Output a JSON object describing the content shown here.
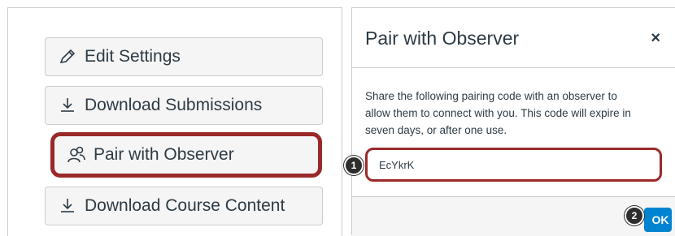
{
  "left_panel": {
    "buttons": [
      {
        "label": "Edit Settings",
        "icon": "pencil-icon"
      },
      {
        "label": "Download Submissions",
        "icon": "download-icon"
      },
      {
        "label": "Pair with Observer",
        "icon": "observer-icon"
      },
      {
        "label": "Download Course Content",
        "icon": "download-icon"
      }
    ]
  },
  "dialog": {
    "title": "Pair with Observer",
    "close_label": "×",
    "description": "Share the following pairing code with an observer to allow them to connect with you. This code will expire in seven days, or after one use.",
    "pairing_code": "EcYkrK",
    "ok_label": "OK"
  },
  "markers": [
    "1",
    "2"
  ],
  "colors": {
    "highlight": "#9b2929",
    "primary_button": "#0084d1",
    "text": "#2d3b45"
  }
}
